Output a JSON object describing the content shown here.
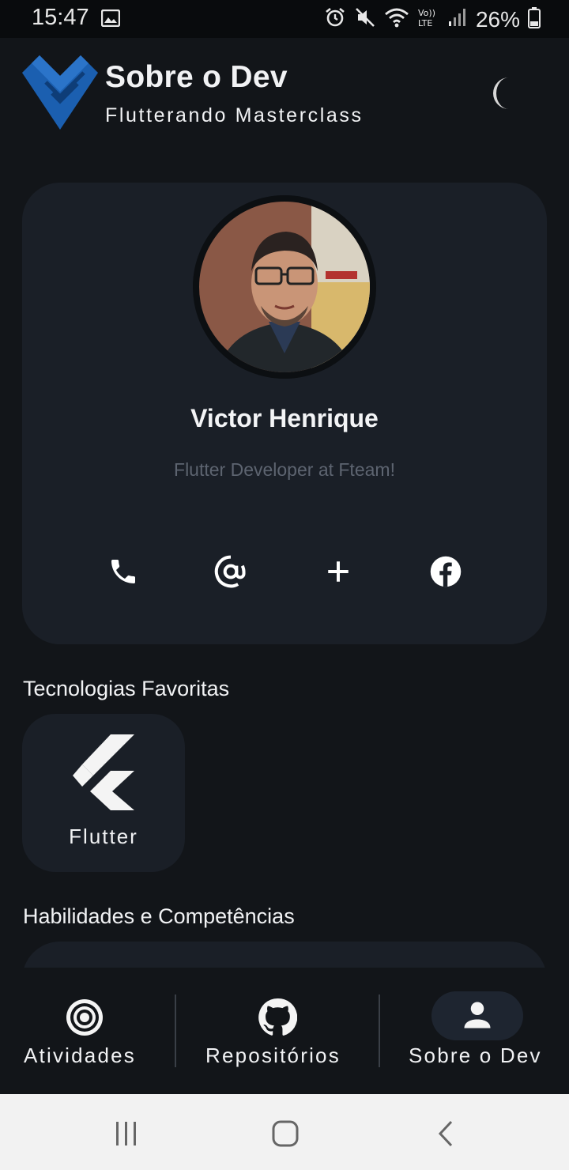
{
  "status_bar": {
    "time": "15:47",
    "battery": "26%",
    "icons": [
      "image-icon",
      "alarm-icon",
      "mute-icon",
      "wifi-icon",
      "volte-icon",
      "signal-icon",
      "battery-icon"
    ]
  },
  "header": {
    "title": "Sobre o Dev",
    "subtitle": "Flutterando Masterclass",
    "logo_icon": "flutterando-logo",
    "theme_icon": "moon-icon"
  },
  "profile": {
    "name": "Victor Henrique",
    "role": "Flutter Developer at Fteam!",
    "contacts": [
      {
        "icon": "phone-icon"
      },
      {
        "icon": "at-icon"
      },
      {
        "icon": "plus-icon"
      },
      {
        "icon": "facebook-icon"
      }
    ]
  },
  "sections": {
    "technologies_title": "Tecnologias Favoritas",
    "skills_title": "Habilidades e Competências"
  },
  "technologies": [
    {
      "label": "Flutter",
      "icon": "flutter-icon"
    }
  ],
  "bottom_nav": {
    "items": [
      {
        "label": "Atividades",
        "icon": "target-icon",
        "active": false
      },
      {
        "label": "Repositórios",
        "icon": "github-icon",
        "active": false
      },
      {
        "label": "Sobre o Dev",
        "icon": "person-icon",
        "active": true
      }
    ]
  },
  "colors": {
    "background": "#121519",
    "card": "#1a1f27",
    "text": "#f1f2f4",
    "muted": "#5d6470",
    "logo_blue": "#1b5fb0"
  }
}
